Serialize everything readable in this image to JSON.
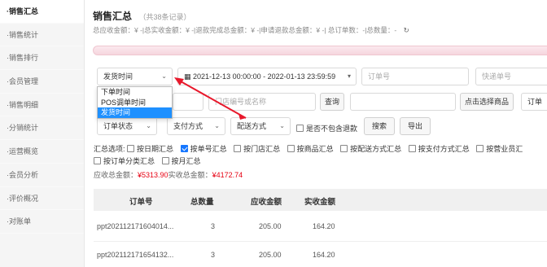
{
  "sidebar": {
    "items": [
      {
        "label": "销售汇总",
        "active": true
      },
      {
        "label": "销售统计"
      },
      {
        "label": "销售排行"
      },
      {
        "label": "会员管理"
      },
      {
        "label": "销售明细"
      },
      {
        "label": "分销统计"
      },
      {
        "label": "运营概览"
      },
      {
        "label": "会员分析"
      },
      {
        "label": "评价概况"
      },
      {
        "label": "对账单"
      }
    ]
  },
  "header": {
    "title": "销售汇总",
    "record_count": "（共38条记录）",
    "summary_text": "总应收金额：¥ -|总实收金额：¥ -|退款完成总金额：¥ -|申请退款总金额：¥ -| 总订单数：-|总数量：-"
  },
  "filters": {
    "time_type": "发货时间",
    "date_range": "2021-12-13 00:00:00 - 2022-01-13 23:59:59",
    "order_no_placeholder": "订单号",
    "express_no_placeholder": "快递单号",
    "store_placeholder": "门店编号或名称",
    "query_label": "查询",
    "select_product_label": "点击选择商品",
    "order_cut": "订单",
    "order_status": "订单状态",
    "payment_method": "支付方式",
    "delivery_method": "配送方式",
    "exclude_refund_label": "是否不包含退款",
    "search_label": "搜索",
    "export_label": "导出"
  },
  "dropdown": {
    "options": [
      "下单时间",
      "POS调单时间",
      "发货时间"
    ],
    "selected_index": 2
  },
  "summary_options": {
    "label": "汇总选项:",
    "row1": [
      {
        "label": "按日期汇总",
        "checked": false
      },
      {
        "label": "按单号汇总",
        "checked": true
      },
      {
        "label": "按门店汇总",
        "checked": false
      },
      {
        "label": "按商品汇总",
        "checked": false
      },
      {
        "label": "按配送方式汇总",
        "checked": false
      },
      {
        "label": "按支付方式汇总",
        "checked": false
      },
      {
        "label": "按营业员汇",
        "checked": false
      }
    ],
    "row2": [
      {
        "label": "按订单分类汇总",
        "checked": false
      },
      {
        "label": "按月汇总",
        "checked": false
      }
    ]
  },
  "totals": {
    "receivable_label": "应收总金额：",
    "receivable_value": "¥5313.90",
    "received_label": "实收总金额：",
    "received_value": "¥4172.74"
  },
  "table": {
    "headers": [
      "订单号",
      "总数量",
      "应收金额",
      "实收金额"
    ],
    "rows": [
      [
        "ppt202112171604014...",
        "3",
        "205.00",
        "164.20"
      ],
      [
        "ppt202112171654132...",
        "3",
        "205.00",
        "164.20"
      ]
    ]
  },
  "colors": {
    "accent": "#1677ff",
    "highlight": "#1e90ff",
    "amount_red": "#e60012",
    "arrow": "#e8192c"
  }
}
